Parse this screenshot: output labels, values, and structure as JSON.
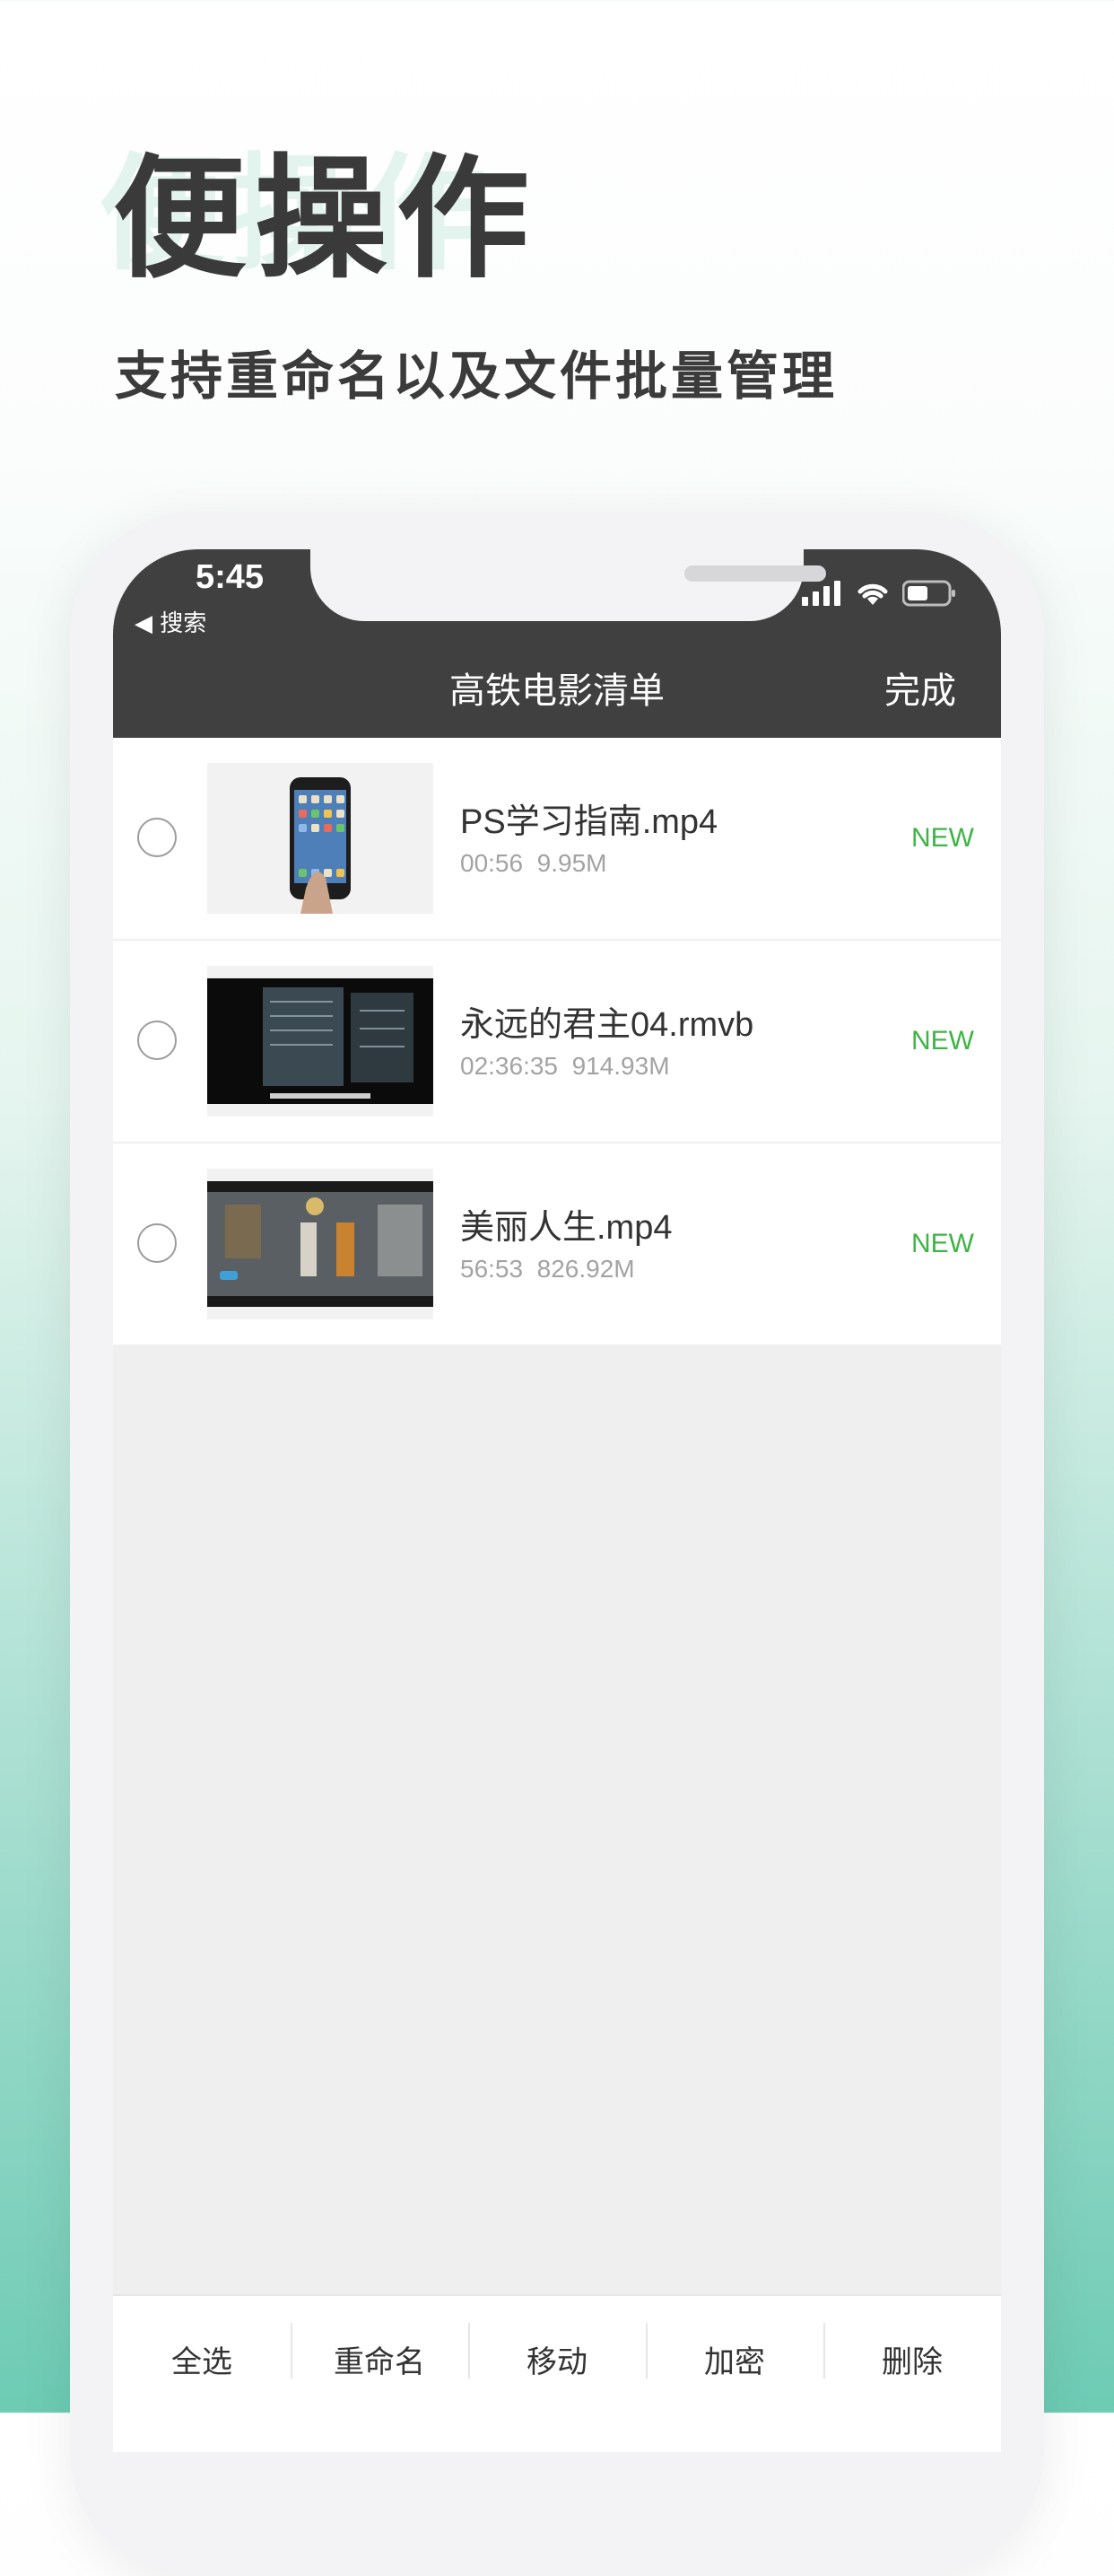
{
  "promo": {
    "title": "便操作",
    "subtitle": "支持重命名以及文件批量管理"
  },
  "status_bar": {
    "time": "5:45",
    "back_label": "◀ 搜索"
  },
  "nav": {
    "title": "高铁电影清单",
    "done_label": "完成"
  },
  "files": [
    {
      "name": "PS学习指南.mp4",
      "duration": "00:56",
      "size": "9.95M",
      "badge": "NEW"
    },
    {
      "name": "永远的君主04.rmvb",
      "duration": "02:36:35",
      "size": "914.93M",
      "badge": "NEW"
    },
    {
      "name": "美丽人生.mp4",
      "duration": "56:53",
      "size": "826.92M",
      "badge": "NEW"
    }
  ],
  "toolbar": {
    "select_all": "全选",
    "rename": "重命名",
    "move": "移动",
    "encrypt": "加密",
    "delete": "删除"
  },
  "colors": {
    "header_bg": "#404040",
    "badge_green": "#3db544",
    "gradient_bottom": "#6dcbb4"
  }
}
